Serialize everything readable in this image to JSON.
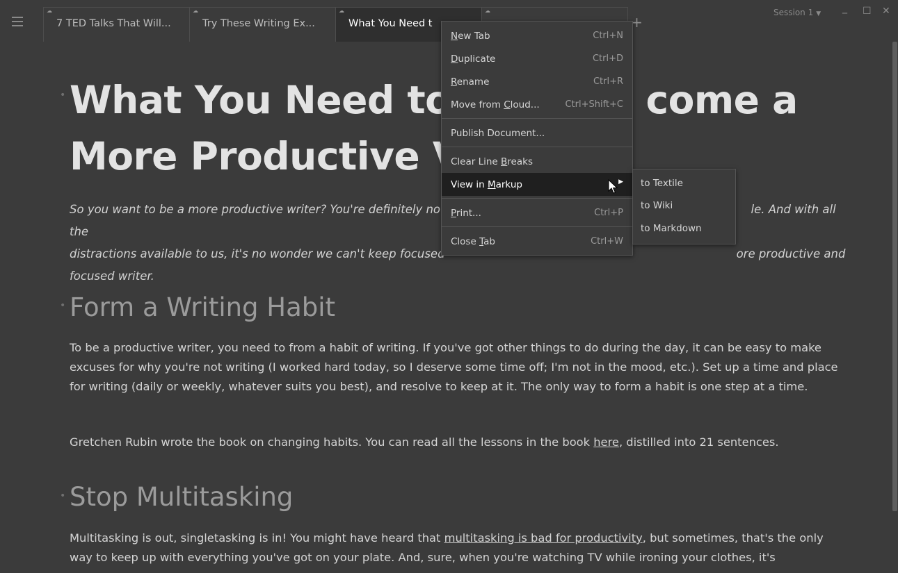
{
  "tabbar": {
    "tabs": [
      {
        "label": "7 TED Talks That Will..."
      },
      {
        "label": "Try These Writing Ex..."
      },
      {
        "label": "What You Need t"
      },
      {
        "label": ""
      }
    ],
    "add_label": "+",
    "session_label": "Session 1",
    "win_min": "_",
    "win_max": "☐",
    "win_close": "✕"
  },
  "document": {
    "title": "What You Need to Become a More Productive Writer",
    "title_line1_left": "What You Need to",
    "title_line1_right": "come a",
    "title_line2": "More Productive V",
    "intro_line1_left": "So you want to be a more productive writer? You're definitely not",
    "intro_line1_right": "le. And with all the",
    "intro_line2_left": "distractions available to us, it's no wonder we can't keep focused",
    "intro_line2_right": "ore productive and",
    "intro_line3": "focused writer.",
    "section1_heading": "Form a Writing Habit",
    "section1_para1": "To be a productive writer, you need to from a habit of writing. If you've got other things to do during the day, it can be easy to make excuses for why you're not writing (I worked hard today, so I deserve some time off; I'm not in the mood, etc.). Set up a time and place for writing (daily or weekly, whatever suits you best), and resolve to keep at it. The only way to form a habit is one step at a time.",
    "section1_para2_a": "Gretchen Rubin wrote the book on changing habits. You can read all the lessons in the book ",
    "section1_para2_link": "here",
    "section1_para2_b": ", distilled into 21 sentences.",
    "section2_heading": "Stop Multitasking",
    "section2_para1_a": "Multitasking is out, singletasking is in! You might have heard that ",
    "section2_para1_link": "multitasking is bad for productivity",
    "section2_para1_b": ", but sometimes, that's the only way to keep up with everything you've got on your plate. And, sure, when you're watching TV while ironing your clothes, it's"
  },
  "context_menu": {
    "new_tab": {
      "label_pre": "",
      "label_ul": "N",
      "label_post": "ew Tab",
      "shortcut": "Ctrl+N"
    },
    "duplicate": {
      "label_pre": "",
      "label_ul": "D",
      "label_post": "uplicate",
      "shortcut": "Ctrl+D"
    },
    "rename": {
      "label_pre": "",
      "label_ul": "R",
      "label_post": "ename",
      "shortcut": "Ctrl+R"
    },
    "move_cloud": {
      "label_pre": "Move from ",
      "label_ul": "C",
      "label_post": "loud...",
      "shortcut": "Ctrl+Shift+C"
    },
    "publish": {
      "label": "Publish Document..."
    },
    "clear_breaks": {
      "label_pre": "Clear Line ",
      "label_ul": "B",
      "label_post": "reaks"
    },
    "view_markup": {
      "label_pre": "View in ",
      "label_ul": "M",
      "label_post": "arkup"
    },
    "print": {
      "label_pre": "",
      "label_ul": "P",
      "label_post": "rint...",
      "shortcut": "Ctrl+P"
    },
    "close_tab": {
      "label_pre": "Close ",
      "label_ul": "T",
      "label_post": "ab",
      "shortcut": "Ctrl+W"
    }
  },
  "submenu": {
    "items": [
      {
        "label": "to Textile"
      },
      {
        "label": "to Wiki"
      },
      {
        "label": "to Markdown"
      }
    ]
  },
  "icons": {
    "menu": "hamburger-icon",
    "cloud": "cloud-icon",
    "submenu_arrow": "submenu-arrow-icon",
    "pointer": "mouse-pointer-icon"
  },
  "colors": {
    "background": "#3b3b3b",
    "active_tab": "#2f2f2f",
    "menu_highlight": "#1f1f1f"
  }
}
